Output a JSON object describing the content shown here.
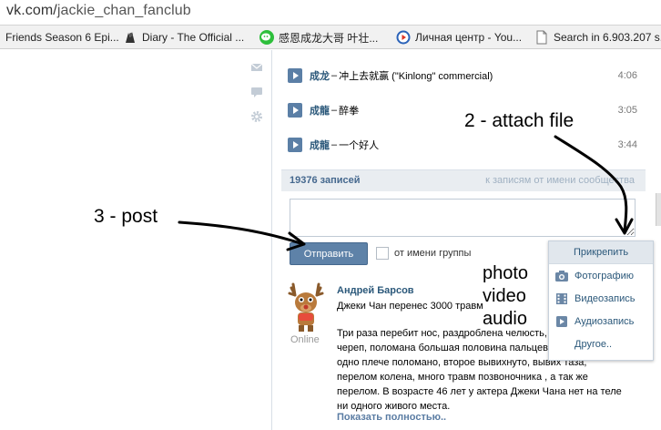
{
  "browser": {
    "url_host": "vk.com/",
    "url_path": "jackie_chan_fanclub",
    "bookmarks": [
      {
        "label": "Friends Season 6 Epi...",
        "icon": "document-icon"
      },
      {
        "label": "Diary - The Official ...",
        "icon": "diary-icon"
      },
      {
        "label": "感恩成龙大哥 叶壮...",
        "icon": "wechat-icon"
      },
      {
        "label": "Личная центр - You...",
        "icon": "play-circle-icon"
      },
      {
        "label": "Search in 6.903.207 s...",
        "icon": "document-icon"
      }
    ]
  },
  "sidebar_icons": [
    "mail-icon",
    "chat-icon",
    "settings-icon"
  ],
  "audio": [
    {
      "artist": "成龙",
      "sep": " – ",
      "title": "冲上去就赢 (\"Kinlong\" commercial)",
      "duration": "4:06"
    },
    {
      "artist": "成龍",
      "sep": " – ",
      "title": "醉拳",
      "duration": "3:05"
    },
    {
      "artist": "成龍",
      "sep": " – ",
      "title": "一个好人",
      "duration": "3:44"
    }
  ],
  "wall": {
    "count": "19376 записей",
    "community_link": "к записям от имени сообщества",
    "send_label": "Отправить",
    "group_label": "от имени группы",
    "composer_value": ""
  },
  "post": {
    "author": "Андрей Барсов",
    "status": "Online",
    "lead": "Джеки Чан перенес 3000 травм",
    "body": [
      "Три раза перебит нос, раздроблена челюсть,",
      "череп, поломана большая половина пальцев,",
      "одно плече поломано, второе вывихнуто, вывих таза,",
      "перелом колена, много травм позвоночника , а так же",
      "перелом. В возрасте 46 лет у актера Джеки Чана нет на теле",
      "ни одного живого места."
    ],
    "show_more": "Показать полностью.."
  },
  "attach_menu": {
    "header": "Прикрепить",
    "items": [
      {
        "label": "Фотографию",
        "icon": "camera-icon"
      },
      {
        "label": "Видеозапись",
        "icon": "film-icon"
      },
      {
        "label": "Аудиозапись",
        "icon": "audio-play-icon"
      },
      {
        "label": "Другое..",
        "icon": ""
      }
    ]
  },
  "annotations": {
    "post": "3 - post",
    "attach": "2 - attach file",
    "media": [
      "photo",
      "video",
      "audio"
    ]
  },
  "colors": {
    "link": "#2b587a",
    "button": "#5e82a8",
    "wall_header": "#e9edf1"
  }
}
